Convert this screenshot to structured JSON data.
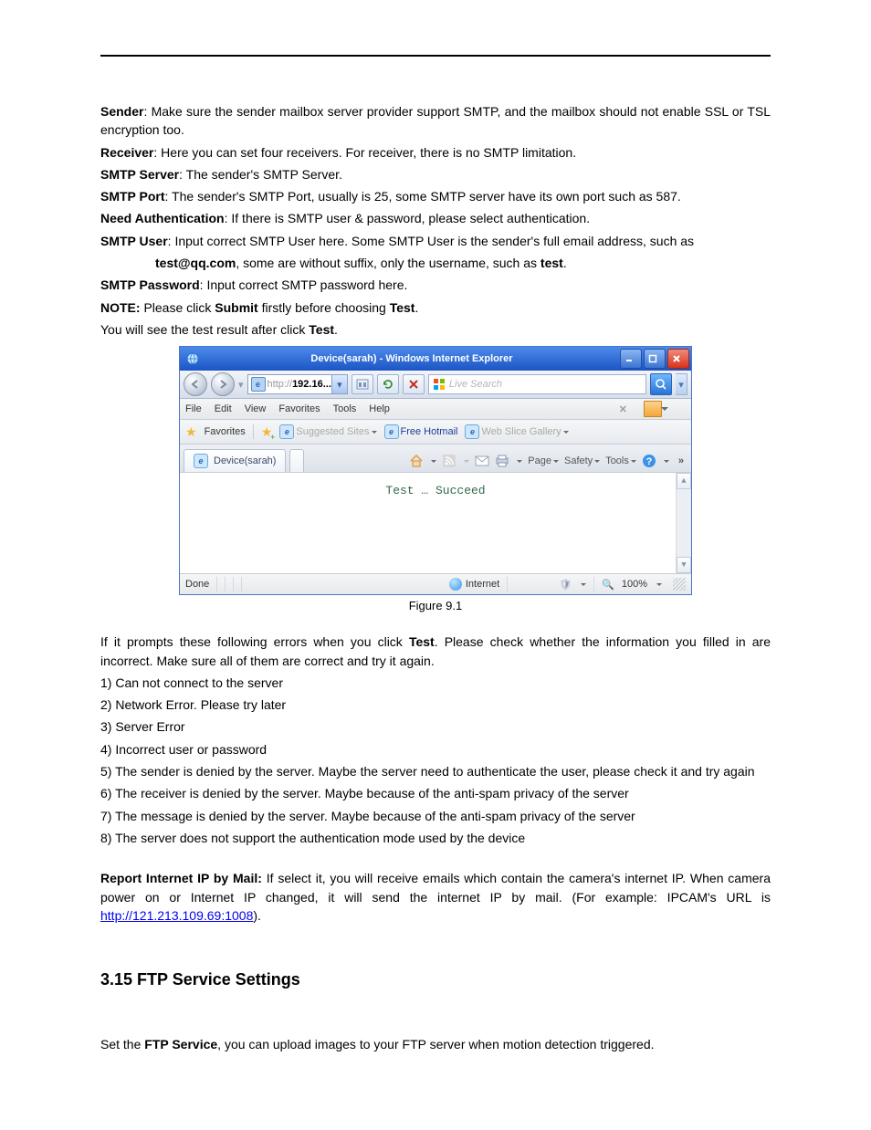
{
  "doc": {
    "p1_a": "Sender",
    "p1_b": ": Make sure the sender mailbox server provider support SMTP, and the mailbox should not enable SSL or TSL encryption too.",
    "p2_a": "Receiver",
    "p2_b": ": Here you can set four receivers. For receiver, there is no SMTP limitation.",
    "p3_a": "SMTP Server",
    "p3_b": ": The sender's SMTP Server.",
    "p4_a": "SMTP Port",
    "p4_b": ": The sender's SMTP Port, usually is 25, some SMTP server have its own port such as 587.",
    "p5_a": "Need Authentication",
    "p5_b": ": If there is SMTP user & password, please select authentication.",
    "p6_a": "SMTP User",
    "p6_b": ": Input correct SMTP User here. Some SMTP User is the sender's full email address, such as",
    "p6_c": "test@qq.com",
    "p6_d": ", some are without suffix, only the username, such as ",
    "p6_e": "test",
    "p6_f": ".",
    "p7_a": "SMTP Password",
    "p7_b": ": Input correct SMTP password here.",
    "p8_a": "NOTE:",
    "p8_b": " Please click ",
    "p8_c": "Submit",
    "p8_d": " firstly before choosing ",
    "p8_e": "Test",
    "p8_f": ".",
    "p9_a": "You will see the test result after click ",
    "p9_b": "Test",
    "p9_c": ".",
    "fig_caption": "Figure 9.1",
    "after1_a": "If it prompts these following errors when you click ",
    "after1_b": "Test",
    "after1_c": ". Please check whether the information you filled in are incorrect. Make sure all of them are correct and try it again.",
    "err1": "1) Can not connect to the server",
    "err2": "2) Network Error. Please try later",
    "err3": "3) Server Error",
    "err4": "4) Incorrect user or password",
    "err5": "5) The sender is denied by the server. Maybe the server need to authenticate the user, please check it and try again",
    "err6": "6) The receiver is denied by the server. Maybe because of the anti-spam privacy of the server",
    "err7": "7) The message is denied by the server. Maybe because of the anti-spam privacy of the server",
    "err8": "8) The server does not support the authentication mode used by the device",
    "report_a": "Report Internet IP by Mail:",
    "report_b": " If select it, you will receive emails which contain the camera's internet IP. When camera power on or Internet IP changed, it will send the internet IP by mail. (For example: IPCAM's URL is ",
    "report_link": "http://121.213.109.69:1008",
    "report_c": ").",
    "section_title": "3.15 FTP Service Settings",
    "ftp_a": "Set the ",
    "ftp_b": "FTP Service",
    "ftp_c": ", you can upload images to your FTP server when motion detection triggered."
  },
  "ie": {
    "title": "Device(sarah) - Windows Internet Explorer",
    "addr_prefix": "http://",
    "addr_bold": "192.16...",
    "search_placeholder": "Live Search",
    "menus": {
      "file": "File",
      "edit": "Edit",
      "view": "View",
      "favorites": "Favorites",
      "tools": "Tools",
      "help": "Help"
    },
    "favbar": {
      "label": "Favorites",
      "suggested": "Suggested Sites",
      "hotmail": "Free Hotmail",
      "gallery": "Web Slice Gallery"
    },
    "tab": "Device(sarah)",
    "cmd": {
      "page": "Page",
      "safety": "Safety",
      "tools": "Tools"
    },
    "content": "Test … Succeed",
    "status": {
      "done": "Done",
      "zone": "Internet",
      "zoom": "100%"
    }
  }
}
